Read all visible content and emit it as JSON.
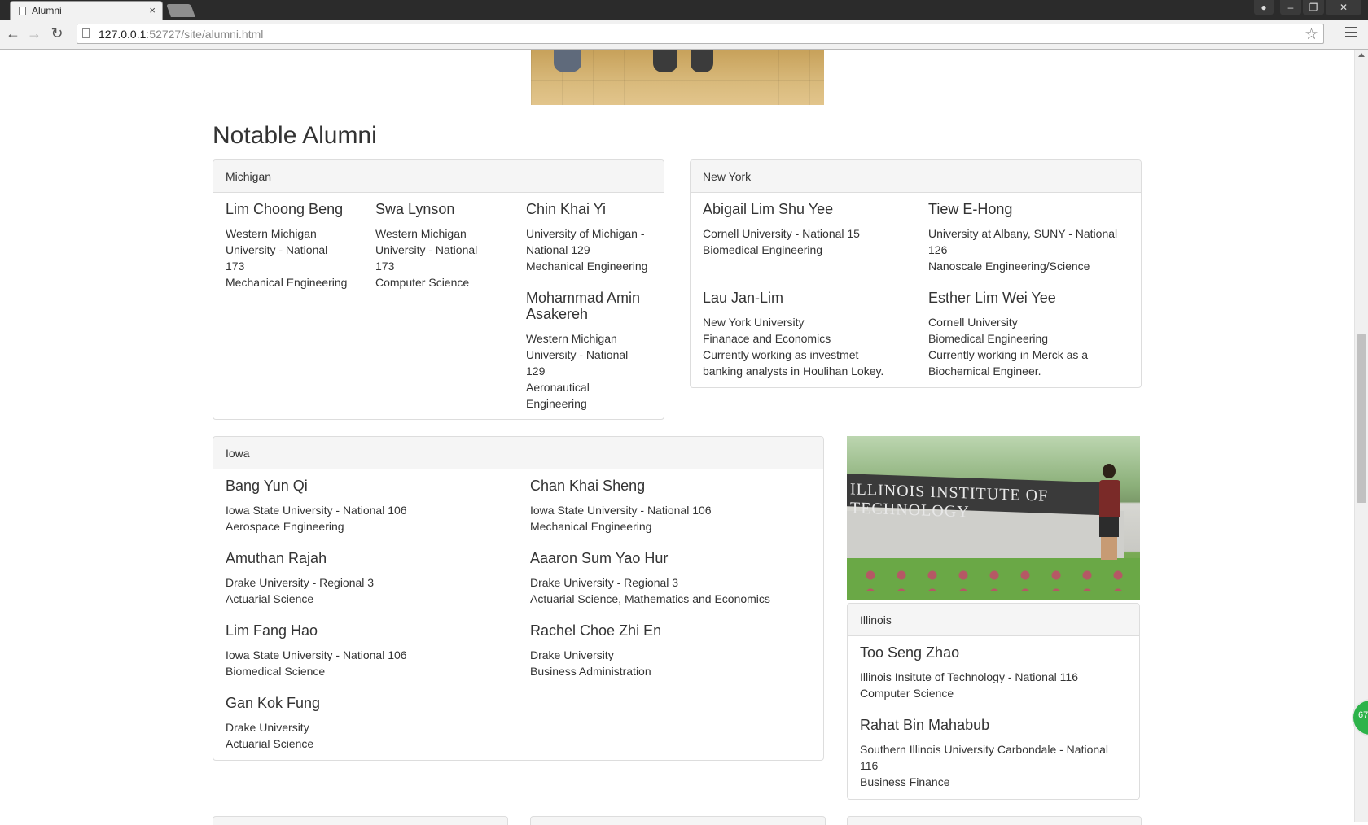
{
  "browser": {
    "tab_title": "Alumni",
    "tab_close": "×",
    "url_host": "127.0.0.1",
    "url_rest": ":52727/site/alumni.html",
    "back": "←",
    "forward": "→",
    "reload": "↻",
    "bookmark": "☆",
    "window_min": "–",
    "window_max": "❐",
    "window_close": "✕"
  },
  "page": {
    "section_title": "Notable Alumni",
    "badge": "67"
  },
  "panels": {
    "michigan": {
      "heading": "Michigan",
      "alumni": [
        {
          "name": "Lim Choong Beng",
          "lines": [
            "Western Michigan",
            "University - National",
            "173",
            "Mechanical Engineering"
          ]
        },
        {
          "name": "Swa Lynson",
          "lines": [
            "Western Michigan",
            "University - National",
            "173",
            "Computer Science"
          ]
        },
        {
          "name": "Chin Khai Yi",
          "lines": [
            "University of Michigan -",
            "National 129",
            "Mechanical Engineering"
          ]
        },
        {
          "name1": "Mohammad Amin",
          "name2": "Asakereh",
          "lines": [
            "Western Michigan",
            "University - National",
            "129",
            "Aeronautical",
            "Engineering"
          ]
        }
      ]
    },
    "new_york": {
      "heading": "New York",
      "alumni": [
        {
          "name": "Abigail Lim Shu Yee",
          "lines": [
            "Cornell University - National 15",
            "Biomedical Engineering"
          ]
        },
        {
          "name": "Tiew E-Hong",
          "lines": [
            "University at Albany, SUNY - National",
            "126",
            "Nanoscale Engineering/Science"
          ]
        },
        {
          "name": "Lau Jan-Lim",
          "lines": [
            "New York University",
            "Finanace and Economics",
            "Currently working as investmet",
            "banking analysts in Houlihan Lokey."
          ]
        },
        {
          "name": "Esther Lim Wei Yee",
          "lines": [
            "Cornell University",
            "Biomedical Engineering",
            "Currently working in Merck as a",
            "Biochemical Engineer."
          ]
        }
      ]
    },
    "iowa": {
      "heading": "Iowa",
      "alumni": [
        {
          "name": "Bang Yun Qi",
          "lines": [
            "Iowa State University - National 106",
            "Aerospace Engineering"
          ]
        },
        {
          "name": "Chan Khai Sheng",
          "lines": [
            "Iowa State University - National 106",
            "Mechanical Engineering"
          ]
        },
        {
          "name": "Amuthan Rajah",
          "lines": [
            "Drake University - Regional 3",
            "Actuarial Science"
          ]
        },
        {
          "name": "Aaaron Sum Yao Hur",
          "lines": [
            "Drake University - Regional 3",
            "Actuarial Science, Mathematics and Economics"
          ]
        },
        {
          "name": "Lim Fang Hao",
          "lines": [
            "Iowa State University - National 106",
            "Biomedical Science"
          ]
        },
        {
          "name": "Rachel Choe Zhi En",
          "lines": [
            "Drake University",
            "Business Administration"
          ]
        },
        {
          "name": "Gan Kok Fung",
          "lines": [
            "Drake University",
            "Actuarial Science"
          ]
        }
      ]
    },
    "illinois": {
      "heading": "Illinois",
      "photo_sign": "ILLINOIS INSTITUTE OF TECHNOLOGY",
      "alumni": [
        {
          "name": "Too Seng Zhao",
          "lines": [
            "Illinois Insitute of Technology - National 116",
            "Computer Science"
          ]
        },
        {
          "name": "Rahat Bin Mahabub",
          "lines": [
            "Southern Illinois University Carbondale - National",
            "116",
            "Business Finance"
          ]
        }
      ]
    }
  }
}
